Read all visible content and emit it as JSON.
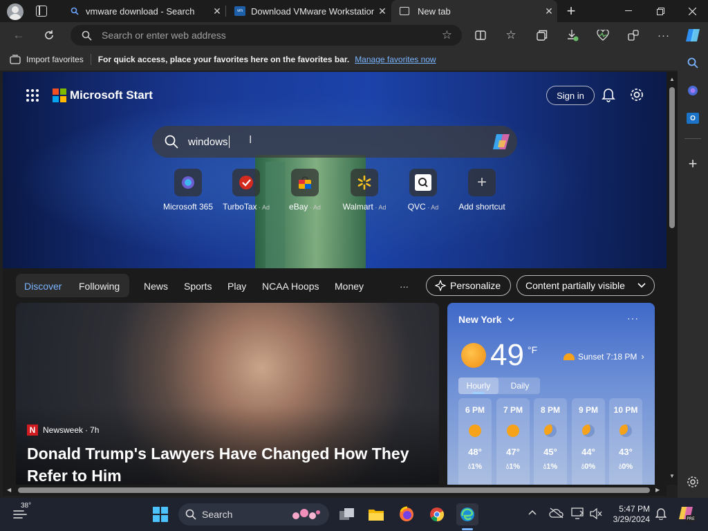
{
  "tabs": [
    {
      "title": "vmware download - Search"
    },
    {
      "title": "Download VMware Workstation P"
    },
    {
      "title": "New tab"
    }
  ],
  "address": {
    "placeholder": "Search or enter web address"
  },
  "favorites": {
    "import_label": "Import favorites",
    "hint": "For quick access, place your favorites here on the favorites bar.",
    "manage_link": "Manage favorites now"
  },
  "header": {
    "brand": "Microsoft Start",
    "signin": "Sign in"
  },
  "search": {
    "value": "windows "
  },
  "shortcuts": [
    {
      "label": "Microsoft 365",
      "ad": ""
    },
    {
      "label": "TurboTax",
      "ad": "Ad"
    },
    {
      "label": "eBay",
      "ad": "Ad"
    },
    {
      "label": "Walmart",
      "ad": "Ad"
    },
    {
      "label": "QVC",
      "ad": "Ad"
    },
    {
      "label": "Add shortcut",
      "ad": ""
    }
  ],
  "feed_nav": {
    "discover": "Discover",
    "following": "Following",
    "items": [
      "News",
      "Sports",
      "Play",
      "NCAA Hoops",
      "Money"
    ],
    "more": "···",
    "personalize": "Personalize",
    "content_visibility": "Content partially visible"
  },
  "article": {
    "source": "Newsweek",
    "age": "7h",
    "source_logo": "N",
    "headline": "Donald Trump's Lawyers Have Changed How They Refer to Him"
  },
  "weather": {
    "location": "New York",
    "temp": "49",
    "unit": "°F",
    "sunset": "Sunset 7:18 PM",
    "tabs": [
      "Hourly",
      "Daily"
    ],
    "hours": [
      {
        "time": "6 PM",
        "icon": "sun",
        "temp": "48°",
        "precip": "1%"
      },
      {
        "time": "7 PM",
        "icon": "sun",
        "temp": "47°",
        "precip": "1%"
      },
      {
        "time": "8 PM",
        "icon": "moon",
        "temp": "45°",
        "precip": "1%"
      },
      {
        "time": "9 PM",
        "icon": "moon",
        "temp": "44°",
        "precip": "0%"
      },
      {
        "time": "10 PM",
        "icon": "moon",
        "temp": "43°",
        "precip": "0%"
      }
    ]
  },
  "taskbar": {
    "weather_temp": "38°",
    "search_label": "Search",
    "time": "5:47 PM",
    "date": "3/29/2024"
  }
}
